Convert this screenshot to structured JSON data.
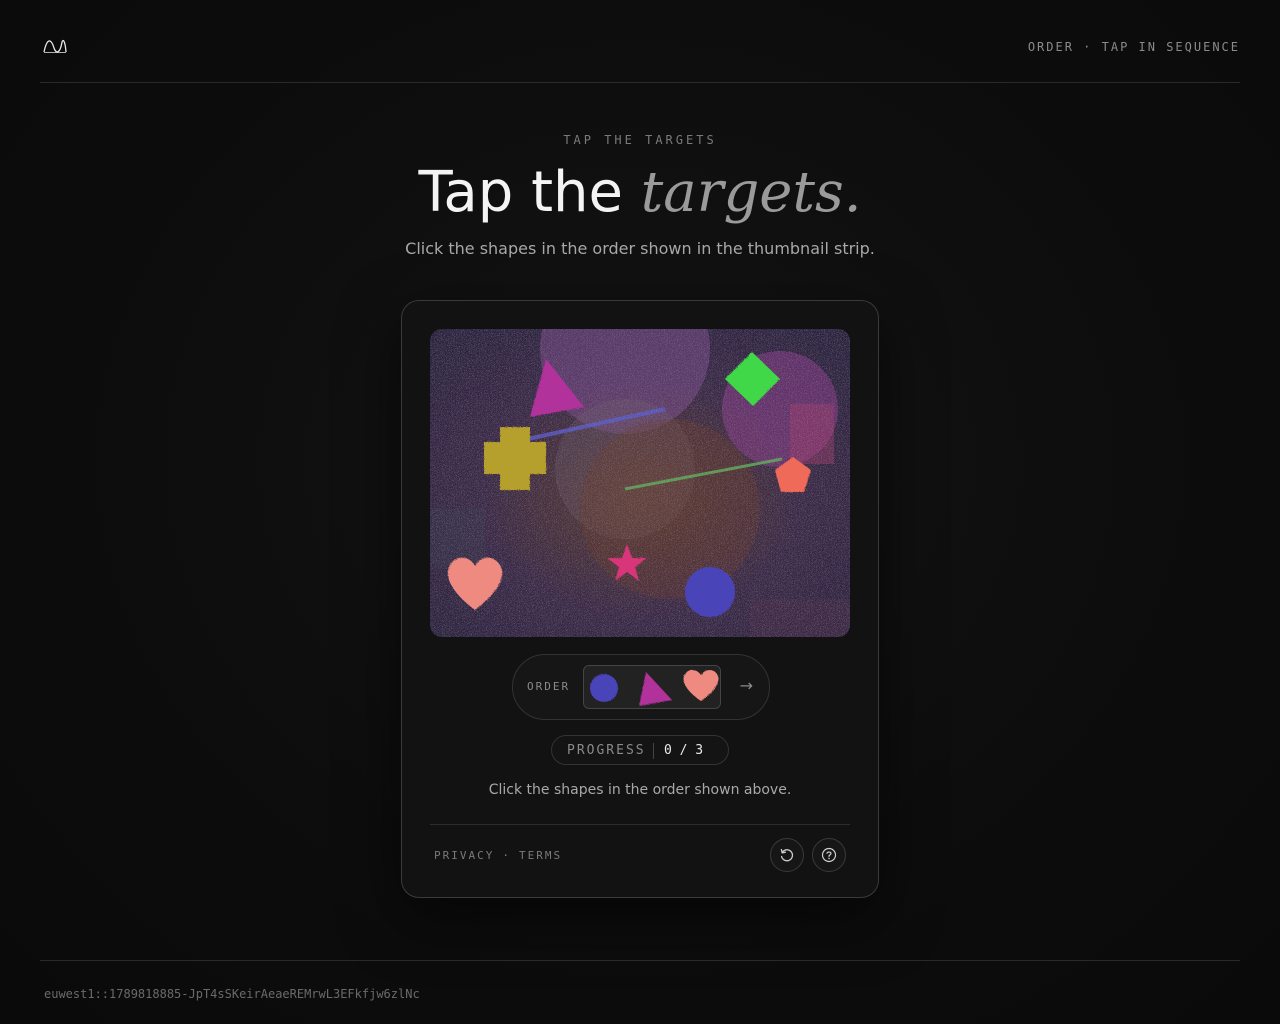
{
  "header": {
    "logo_icon": "wave-logo-icon",
    "right_label": "ORDER · TAP IN SEQUENCE"
  },
  "hero": {
    "eyebrow": "TAP THE TARGETS",
    "title_plain": "Tap the ",
    "title_italic": "targets.",
    "subtitle": "Click the shapes in the order shown in the thumbnail strip."
  },
  "challenge": {
    "canvas_shapes": [
      {
        "name": "green-diamond",
        "color": "#3fd84a"
      },
      {
        "name": "magenta-triangle",
        "color": "#b0309a"
      },
      {
        "name": "yellow-cross",
        "color": "#b5a02e"
      },
      {
        "name": "salmon-pentagon",
        "color": "#f06a5a"
      },
      {
        "name": "pink-star",
        "color": "#d8347a"
      },
      {
        "name": "salmon-heart",
        "color": "#ef8a80"
      },
      {
        "name": "blue-circle",
        "color": "#4a44b8"
      }
    ],
    "order": {
      "label": "ORDER",
      "sequence": [
        "circle",
        "triangle",
        "heart"
      ],
      "next_icon": "arrow-right-icon",
      "next_glyph": "→"
    },
    "progress": {
      "label": "PROGRESS",
      "value": "0 / 3"
    },
    "instruction": "Click the shapes in the order shown above."
  },
  "footer": {
    "privacy": "PRIVACY",
    "separator": "·",
    "terms": "TERMS",
    "refresh_icon": "refresh-icon",
    "help_icon": "help-icon"
  },
  "session_id": "euwest1::1789818885-JpT4sSKeirAeaeREMrwL3EFkfjw6zlNc"
}
